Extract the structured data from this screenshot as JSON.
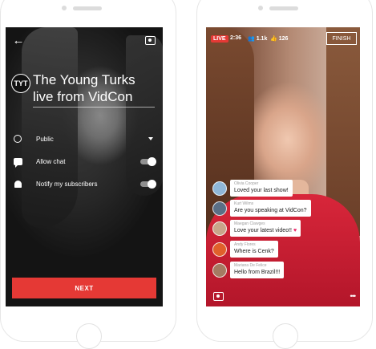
{
  "left_screen": {
    "logo_text": "TYT",
    "title": "The Young Turks live from VidCon",
    "settings": [
      {
        "icon": "globe-icon",
        "label": "Public",
        "control": "dropdown"
      },
      {
        "icon": "chat-icon",
        "label": "Allow chat",
        "control": "toggle",
        "on": true
      },
      {
        "icon": "bell-icon",
        "label": "Notify my subscribers",
        "control": "toggle",
        "on": true
      }
    ],
    "next_label": "NEXT",
    "accent_color": "#e53935"
  },
  "right_screen": {
    "live_label": "LIVE",
    "elapsed": "2:36",
    "viewers": "1.1k",
    "likes": "126",
    "finish_label": "FINISH",
    "chat": [
      {
        "name": "Olivia Cooper",
        "message": "Loved your last show!",
        "avatar_color": "#8fb7d8"
      },
      {
        "name": "Kurt Wilms",
        "message": "Are you speaking at VidCon?",
        "avatar_color": "#5b6f86"
      },
      {
        "name": "Maegan Clawges",
        "message": "Love your latest video!!",
        "avatar_color": "#c9a58a"
      },
      {
        "name": "Andy Flores",
        "message": "Where is Cenk?",
        "avatar_color": "#e0602b"
      },
      {
        "name": "Mariana De Felice",
        "message": "Hello from Brazil!!!",
        "avatar_color": "#a57a62"
      }
    ]
  }
}
